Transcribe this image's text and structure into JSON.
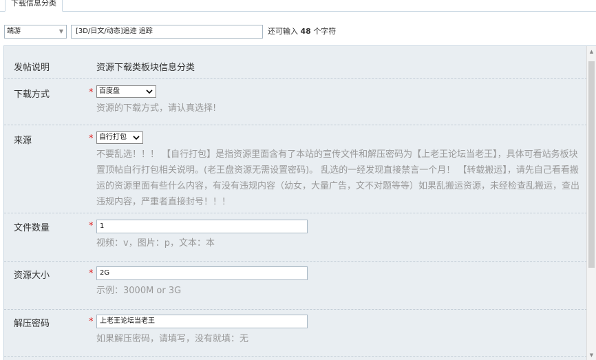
{
  "tab": {
    "label": "下载信息分类"
  },
  "title_row": {
    "type_select": "端游",
    "title_value": "[3D/日文/动态]追迹 追踪",
    "remain_prefix": "还可输入",
    "remain_count": "48",
    "remain_suffix": "个字符"
  },
  "form": {
    "intro": {
      "label": "发帖说明",
      "text": "资源下载类板块信息分类"
    },
    "download_method": {
      "label": "下载方式",
      "required": "*",
      "selected": "百度盘",
      "hint": "资源的下载方式，请认真选择!"
    },
    "source": {
      "label": "来源",
      "required": "*",
      "selected": "自行打包",
      "hint_lines": [
        "不要乱选！！！ 【自行打包】是指资源里面含有了本站的宣传文件和解压密码为【上老王论坛当老王】，具体可看站务板块",
        "置顶帖自行打包相关说明。(老王盘资源无需设置密码)。 乱选的一经发现直接禁言一个月！ 【转载搬运】，请先自己看看搬",
        "运的资源里面有些什么内容，有没有违规内容（幼女，大量广告，文不对题等等）如果乱搬运资源，未经检查乱搬运，查出",
        "违规内容，严重者直接封号！！！"
      ]
    },
    "file_count": {
      "label": "文件数量",
      "required": "*",
      "value": "1",
      "hint": "视频：v，图片：p，文本：本"
    },
    "size": {
      "label": "资源大小",
      "required": "*",
      "value": "2G",
      "hint": "示例：3000M or 3G"
    },
    "password": {
      "label": "解压密码",
      "required": "*",
      "value": "上老王论坛当老王",
      "hint": "如果解压密码，请填写，没有就填：无"
    }
  }
}
